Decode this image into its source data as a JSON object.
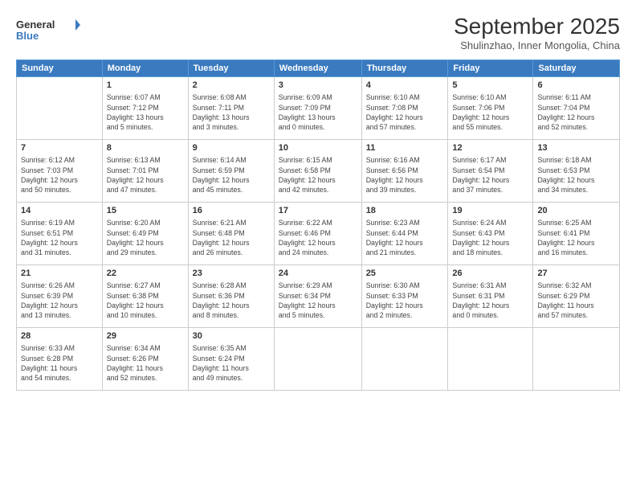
{
  "header": {
    "logo_line1": "General",
    "logo_line2": "Blue",
    "main_title": "September 2025",
    "subtitle": "Shulinzhao, Inner Mongolia, China"
  },
  "weekdays": [
    "Sunday",
    "Monday",
    "Tuesday",
    "Wednesday",
    "Thursday",
    "Friday",
    "Saturday"
  ],
  "weeks": [
    [
      {
        "day": "",
        "info": ""
      },
      {
        "day": "1",
        "info": "Sunrise: 6:07 AM\nSunset: 7:12 PM\nDaylight: 13 hours\nand 5 minutes."
      },
      {
        "day": "2",
        "info": "Sunrise: 6:08 AM\nSunset: 7:11 PM\nDaylight: 13 hours\nand 3 minutes."
      },
      {
        "day": "3",
        "info": "Sunrise: 6:09 AM\nSunset: 7:09 PM\nDaylight: 13 hours\nand 0 minutes."
      },
      {
        "day": "4",
        "info": "Sunrise: 6:10 AM\nSunset: 7:08 PM\nDaylight: 12 hours\nand 57 minutes."
      },
      {
        "day": "5",
        "info": "Sunrise: 6:10 AM\nSunset: 7:06 PM\nDaylight: 12 hours\nand 55 minutes."
      },
      {
        "day": "6",
        "info": "Sunrise: 6:11 AM\nSunset: 7:04 PM\nDaylight: 12 hours\nand 52 minutes."
      }
    ],
    [
      {
        "day": "7",
        "info": "Sunrise: 6:12 AM\nSunset: 7:03 PM\nDaylight: 12 hours\nand 50 minutes."
      },
      {
        "day": "8",
        "info": "Sunrise: 6:13 AM\nSunset: 7:01 PM\nDaylight: 12 hours\nand 47 minutes."
      },
      {
        "day": "9",
        "info": "Sunrise: 6:14 AM\nSunset: 6:59 PM\nDaylight: 12 hours\nand 45 minutes."
      },
      {
        "day": "10",
        "info": "Sunrise: 6:15 AM\nSunset: 6:58 PM\nDaylight: 12 hours\nand 42 minutes."
      },
      {
        "day": "11",
        "info": "Sunrise: 6:16 AM\nSunset: 6:56 PM\nDaylight: 12 hours\nand 39 minutes."
      },
      {
        "day": "12",
        "info": "Sunrise: 6:17 AM\nSunset: 6:54 PM\nDaylight: 12 hours\nand 37 minutes."
      },
      {
        "day": "13",
        "info": "Sunrise: 6:18 AM\nSunset: 6:53 PM\nDaylight: 12 hours\nand 34 minutes."
      }
    ],
    [
      {
        "day": "14",
        "info": "Sunrise: 6:19 AM\nSunset: 6:51 PM\nDaylight: 12 hours\nand 31 minutes."
      },
      {
        "day": "15",
        "info": "Sunrise: 6:20 AM\nSunset: 6:49 PM\nDaylight: 12 hours\nand 29 minutes."
      },
      {
        "day": "16",
        "info": "Sunrise: 6:21 AM\nSunset: 6:48 PM\nDaylight: 12 hours\nand 26 minutes."
      },
      {
        "day": "17",
        "info": "Sunrise: 6:22 AM\nSunset: 6:46 PM\nDaylight: 12 hours\nand 24 minutes."
      },
      {
        "day": "18",
        "info": "Sunrise: 6:23 AM\nSunset: 6:44 PM\nDaylight: 12 hours\nand 21 minutes."
      },
      {
        "day": "19",
        "info": "Sunrise: 6:24 AM\nSunset: 6:43 PM\nDaylight: 12 hours\nand 18 minutes."
      },
      {
        "day": "20",
        "info": "Sunrise: 6:25 AM\nSunset: 6:41 PM\nDaylight: 12 hours\nand 16 minutes."
      }
    ],
    [
      {
        "day": "21",
        "info": "Sunrise: 6:26 AM\nSunset: 6:39 PM\nDaylight: 12 hours\nand 13 minutes."
      },
      {
        "day": "22",
        "info": "Sunrise: 6:27 AM\nSunset: 6:38 PM\nDaylight: 12 hours\nand 10 minutes."
      },
      {
        "day": "23",
        "info": "Sunrise: 6:28 AM\nSunset: 6:36 PM\nDaylight: 12 hours\nand 8 minutes."
      },
      {
        "day": "24",
        "info": "Sunrise: 6:29 AM\nSunset: 6:34 PM\nDaylight: 12 hours\nand 5 minutes."
      },
      {
        "day": "25",
        "info": "Sunrise: 6:30 AM\nSunset: 6:33 PM\nDaylight: 12 hours\nand 2 minutes."
      },
      {
        "day": "26",
        "info": "Sunrise: 6:31 AM\nSunset: 6:31 PM\nDaylight: 12 hours\nand 0 minutes."
      },
      {
        "day": "27",
        "info": "Sunrise: 6:32 AM\nSunset: 6:29 PM\nDaylight: 11 hours\nand 57 minutes."
      }
    ],
    [
      {
        "day": "28",
        "info": "Sunrise: 6:33 AM\nSunset: 6:28 PM\nDaylight: 11 hours\nand 54 minutes."
      },
      {
        "day": "29",
        "info": "Sunrise: 6:34 AM\nSunset: 6:26 PM\nDaylight: 11 hours\nand 52 minutes."
      },
      {
        "day": "30",
        "info": "Sunrise: 6:35 AM\nSunset: 6:24 PM\nDaylight: 11 hours\nand 49 minutes."
      },
      {
        "day": "",
        "info": ""
      },
      {
        "day": "",
        "info": ""
      },
      {
        "day": "",
        "info": ""
      },
      {
        "day": "",
        "info": ""
      }
    ]
  ]
}
